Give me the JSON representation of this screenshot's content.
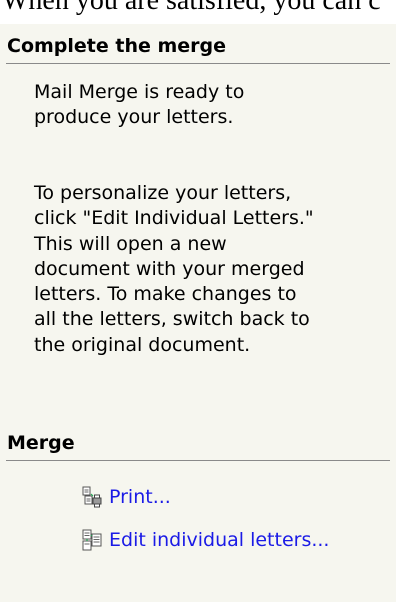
{
  "top_text": "When you are satisfied, you can c",
  "complete_section": {
    "title": "Complete the merge",
    "para1": "Mail Merge is ready to\nproduce your letters.",
    "para2": "To personalize your letters,\nclick \"Edit Individual Letters.\"\nThis will open a new\ndocument with your merged\nletters. To make changes to\nall the letters, switch back to\nthe original document."
  },
  "merge_section": {
    "title": "Merge",
    "links": [
      {
        "label": "Print...",
        "icon": "print-icon"
      },
      {
        "label": "Edit individual letters...",
        "icon": "edit-letters-icon"
      }
    ]
  },
  "colors": {
    "link": "#1a1ae6",
    "background": "#f6f6ef",
    "rule": "#8a8a8a"
  }
}
